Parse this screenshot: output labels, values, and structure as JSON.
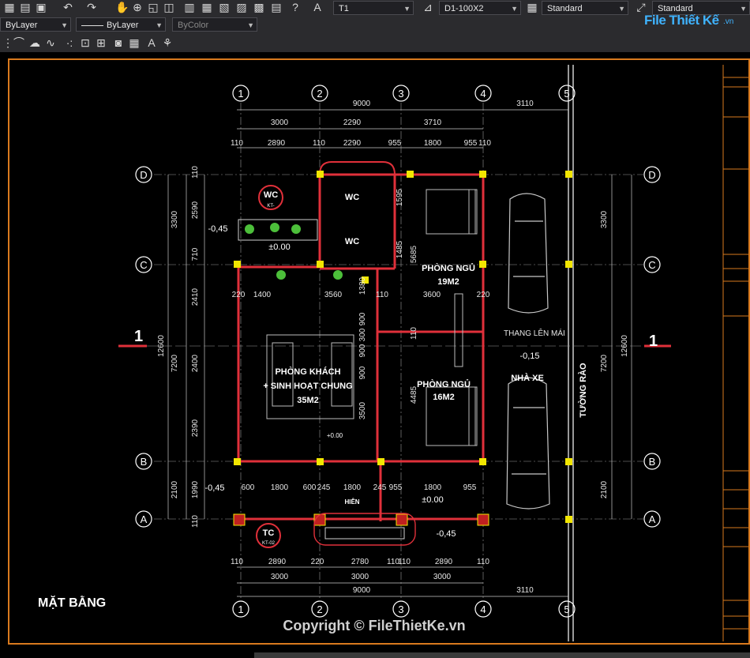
{
  "toolbar": {
    "text_style": "T1",
    "dim_style": "D1-100X2",
    "table_style": "Standard",
    "multileader_style": "Standard",
    "layer_linetype": "ByLayer",
    "lineweight": "ByLayer",
    "plot_style": "ByColor",
    "color_layer": "ByLayer"
  },
  "logo": {
    "brand": "File Thiết Kế",
    "tld": ".vn"
  },
  "drawing": {
    "title": "MẶT BẰNG",
    "copyright": "Copyright © FileThietKe.vn",
    "grid_cols": [
      "1",
      "2",
      "3",
      "4",
      "5"
    ],
    "grid_rows": [
      "D",
      "C",
      "B",
      "A"
    ],
    "section_marks": [
      "1",
      "1"
    ],
    "top_dims": {
      "row1": [
        "9000",
        "3110"
      ],
      "row2": [
        "3000",
        "2290",
        "3710"
      ],
      "row3": [
        "110",
        "2890",
        "110",
        "2290",
        "955",
        "1800",
        "955",
        "110"
      ]
    },
    "bottom_dims": {
      "row1": [
        "110",
        "2890",
        "220",
        "2780",
        "110",
        "110",
        "2890",
        "110"
      ],
      "row2": [
        "3000",
        "3000",
        "3000"
      ],
      "row3": [
        "9000",
        "3110"
      ]
    },
    "left_dims": [
      "3300",
      "2590",
      "710",
      "2410",
      "7200",
      "2400",
      "2390",
      "12600",
      "2100",
      "1990",
      "110",
      "110"
    ],
    "right_dims": [
      "3300",
      "7200",
      "12600",
      "2100"
    ],
    "rooms": {
      "wc1": "WC",
      "wc2": "WC",
      "bedroom1_name": "PHÒNG NGỦ",
      "bedroom1_area": "19M2",
      "bedroom2_name": "PHÒNG NGỦ",
      "bedroom2_area": "16M2",
      "living_line1": "PHÒNG KHÁCH",
      "living_line2": "+ SINH HOẠT CHUNG",
      "living_area": "35M2",
      "garage": "NHÀ XE",
      "stair": "THANG LÊN MÁI",
      "porch": "HIÊN",
      "fence": "TƯỜNG RÀO"
    },
    "levels": [
      "-0,45",
      "±0.00",
      "-0,15",
      "+0.00",
      "±0.00",
      "-0,45",
      "-0,45"
    ],
    "tags": {
      "wc_tag": "WC",
      "wc_sub": "KT-",
      "tc_tag": "TC",
      "tc_sub": "KT-02"
    },
    "inner_dims": [
      "1400",
      "3560",
      "1380",
      "110",
      "3600",
      "220",
      "220",
      "1595",
      "1485",
      "5685",
      "900",
      "300",
      "900",
      "110",
      "900",
      "3500",
      "4485",
      "1800",
      "600",
      "245",
      "1800",
      "245",
      "955",
      "1800",
      "955",
      "600"
    ]
  },
  "colors": {
    "accent": "#d97a1e",
    "wall": "#e0303a",
    "grid": "#ffffff",
    "column": "#f2e600",
    "dim": "#d0d0d0",
    "logo": "#3fb3ff"
  }
}
